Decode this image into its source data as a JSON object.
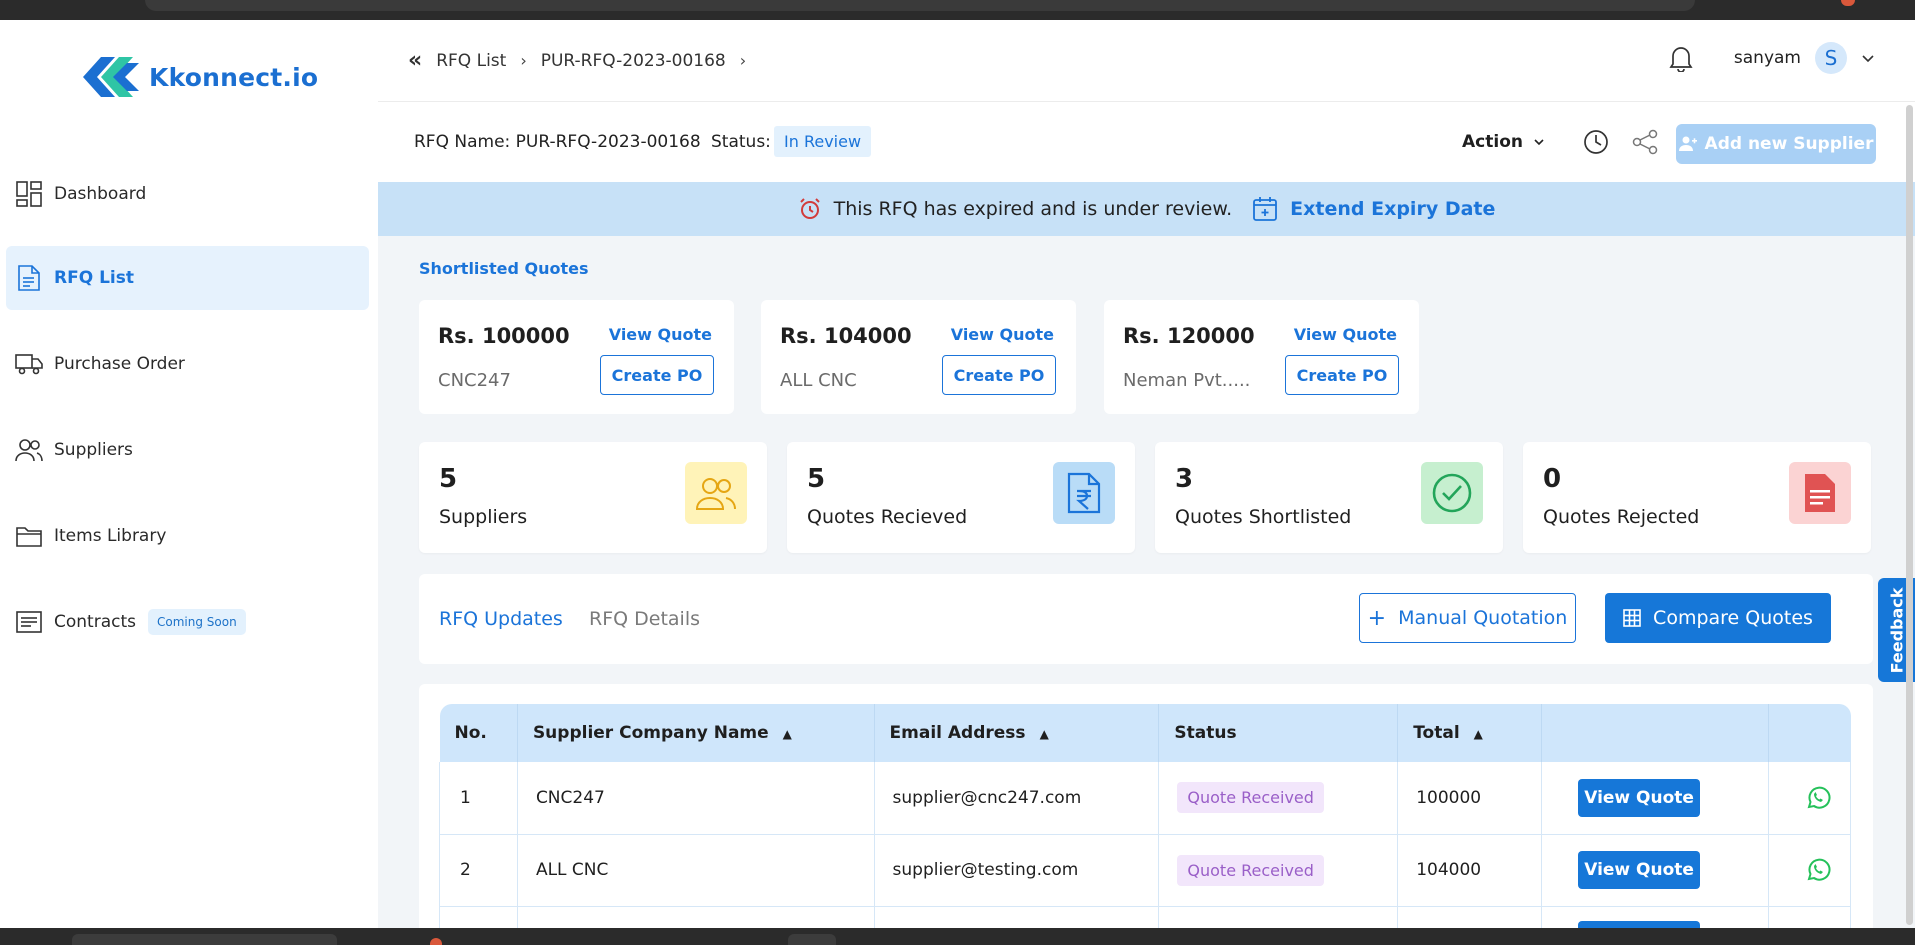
{
  "brand": {
    "name": "Kkonnect.io"
  },
  "sidebar": {
    "items": [
      {
        "label": "Dashboard",
        "icon": "dashboard-icon"
      },
      {
        "label": "RFQ List",
        "icon": "document-icon"
      },
      {
        "label": "Purchase Order",
        "icon": "truck-icon"
      },
      {
        "label": "Suppliers",
        "icon": "users-icon"
      },
      {
        "label": "Items Library",
        "icon": "folder-icon"
      },
      {
        "label": "Contracts",
        "icon": "list-icon",
        "badge": "Coming Soon"
      }
    ]
  },
  "header": {
    "breadcrumb": [
      "RFQ List",
      "PUR-RFQ-2023-00168"
    ],
    "user_name": "sanyam",
    "avatar_initial": "S"
  },
  "rfq": {
    "name_label": "RFQ Name: PUR-RFQ-2023-00168",
    "status_label": "Status:",
    "status_value": "In Review",
    "action_label": "Action",
    "add_supplier_label": "Add new Supplier"
  },
  "banner": {
    "message": "This RFQ has expired and is under review.",
    "link": "Extend Expiry Date"
  },
  "shortlisted": {
    "title": "Shortlisted Quotes",
    "quotes": [
      {
        "price": "Rs. 100000",
        "supplier": "CNC247",
        "view": "View Quote",
        "create": "Create PO"
      },
      {
        "price": "Rs. 104000",
        "supplier": "ALL CNC",
        "view": "View Quote",
        "create": "Create PO"
      },
      {
        "price": "Rs. 120000",
        "supplier": "Neman Pvt.....",
        "view": "View Quote",
        "create": "Create PO"
      }
    ]
  },
  "stats": [
    {
      "value": "5",
      "label": "Suppliers",
      "icon": "users-icon",
      "color": "#fff3b8"
    },
    {
      "value": "5",
      "label": "Quotes Recieved",
      "icon": "rupee-document-icon",
      "color": "#b9dcf7"
    },
    {
      "value": "3",
      "label": "Quotes Shortlisted",
      "icon": "check-circle-icon",
      "color": "#c6efcf"
    },
    {
      "value": "0",
      "label": "Quotes Rejected",
      "icon": "document-icon",
      "color": "#fbd3d3"
    }
  ],
  "tabs": {
    "updates": "RFQ Updates",
    "details": "RFQ Details"
  },
  "buttons": {
    "manual": "Manual Quotation",
    "compare": "Compare Quotes"
  },
  "table": {
    "headers": [
      "No.",
      "Supplier Company Name",
      "Email Address",
      "Status",
      "Total"
    ],
    "rows": [
      {
        "no": "1",
        "company": "CNC247",
        "email": "supplier@cnc247.com",
        "status": "Quote Received",
        "total": "100000",
        "action": "View Quote"
      },
      {
        "no": "2",
        "company": "ALL CNC",
        "email": "supplier@testing.com",
        "status": "Quote Received",
        "total": "104000",
        "action": "View Quote"
      }
    ]
  },
  "feedback_label": "Feedback",
  "colors": {
    "primary": "#1677d8",
    "banner": "#c7e1f7",
    "active_nav": "#e6f2fd"
  }
}
